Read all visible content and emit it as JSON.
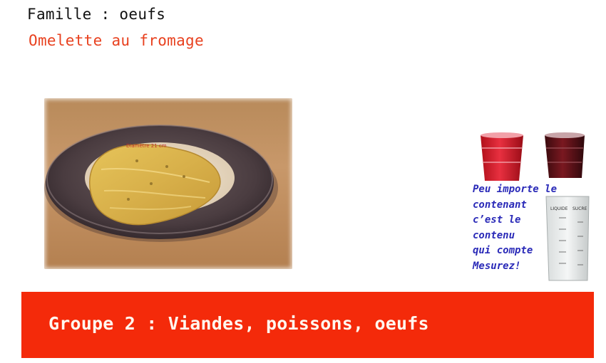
{
  "header": {
    "family_label": "Famille : oeufs",
    "dish_name": "Omelette au fromage"
  },
  "photo": {
    "plate_label": "Diamètre 21 cm"
  },
  "measure_panel": {
    "caption_lines": [
      "Peu importe le",
      "contenant",
      "c’est le",
      "contenu",
      "qui compte",
      "Mesurez!"
    ],
    "jug_labels": [
      "LIQUIDE",
      "SUCRE"
    ]
  },
  "banner": {
    "text": "Groupe 2 : Viandes, poissons, oeufs",
    "color": "#f42a0a"
  },
  "colors": {
    "dish_name": "#e8411f",
    "caption": "#2a2ab8"
  }
}
